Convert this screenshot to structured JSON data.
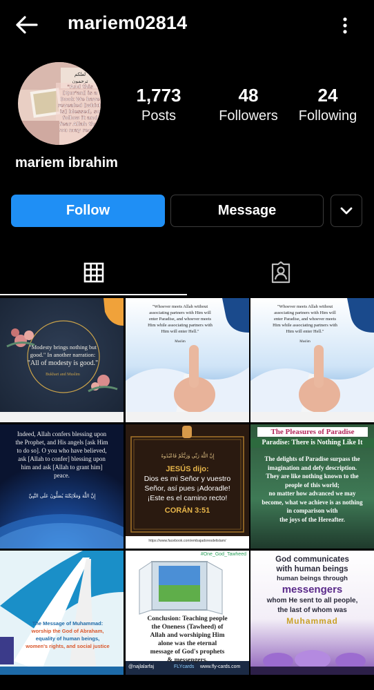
{
  "header": {
    "username": "mariem02814",
    "back_icon": "arrow-left-icon",
    "more_icon": "more-vertical-icon"
  },
  "profile": {
    "avatar_lines": [
      "\"And this",
      "[Qur'an] is a",
      "Book We have",
      "revealed [which",
      "is] blessed, so",
      "follow it and",
      "fear Allah that",
      "you may receive"
    ],
    "display_name": "mariem ibrahim",
    "stats": {
      "posts": {
        "value": "1,773",
        "label": "Posts"
      },
      "followers": {
        "value": "48",
        "label": "Followers"
      },
      "following": {
        "value": "24",
        "label": "Following"
      }
    }
  },
  "actions": {
    "follow": "Follow",
    "message": "Message",
    "suggest_icon": "chevron-down-icon"
  },
  "tabs": {
    "grid_icon": "grid-icon",
    "tagged_icon": "tagged-person-icon",
    "active": "grid"
  },
  "posts": [
    {
      "id": "p1",
      "text": [
        "\"Modesty brings nothing but",
        "good.\" In another narration:",
        "\"All of modesty is good.\""
      ],
      "source": "Bukhari and Muslim"
    },
    {
      "id": "p2",
      "text": [
        "\"Whoever meets Allah without",
        "associating partners with Him will",
        "enter Paradise, and whoever meets",
        "Him while associating partners with",
        "Him will enter Hell.\""
      ],
      "source": "Muslim"
    },
    {
      "id": "p3",
      "text": [
        "\"Whoever meets Allah without",
        "associating partners with Him will",
        "enter Paradise, and whoever meets",
        "Him while associating partners with",
        "Him will enter Hell.\""
      ],
      "source": "Muslim"
    },
    {
      "id": "p4",
      "text": [
        "Indeed, Allah confers blessing upon",
        "the Prophet, and His angels [ask Him",
        "to do so]. O you who have believed,",
        "ask [Allah to confer] blessing upon",
        "him and ask [Allah to grant him]",
        "peace."
      ]
    },
    {
      "id": "p5",
      "title": "JESÚS dijo:",
      "text": [
        "Dios es mi Señor y vuestro",
        "Señor, así pues ¡Adoradle!",
        "¡Este es el camino recto!"
      ],
      "ref": "CORÁN 3:51",
      "url": "https://www.facebook.com/embajadoresdelislam/"
    },
    {
      "id": "p6",
      "title": "The Pleasures of Paradise",
      "subtitle": "Paradise: There is Nothing Like It",
      "text": [
        "The delights of Paradise surpass the",
        "imagination and defy description.",
        "They are like nothing known to the",
        "people of this world;",
        "no matter how advanced we may",
        "become, what we achieve is as nothing",
        "in comparison with",
        "the joys of the Hereafter."
      ]
    },
    {
      "id": "p7",
      "title": "The Message of Muhammad:",
      "text": [
        "worship the God of Abraham,",
        "equality of human beings,",
        "women's rights, and social justice"
      ]
    },
    {
      "id": "p8",
      "hashtag": "#One_God_Tawheed",
      "text": [
        "Conclusion: Teaching people",
        "the Oneness (Tawheed) of",
        "Allah and worshiping Him",
        "alone was the eternal",
        "message of God's prophets",
        "& messengers."
      ],
      "handle": "@najlalarfaj",
      "site": "www.fly-cards.com",
      "brand": "FLYcards"
    },
    {
      "id": "p9",
      "text": [
        "God communicates",
        "with human beings",
        "human beings through"
      ],
      "highlight": "messengers",
      "text2": [
        "whom He sent to all people,",
        "the last of whom was"
      ],
      "name": "Muhammad"
    }
  ],
  "colors": {
    "background": "#000000",
    "follow_button": "#1f8ff5",
    "border": "#3c3c3c"
  }
}
